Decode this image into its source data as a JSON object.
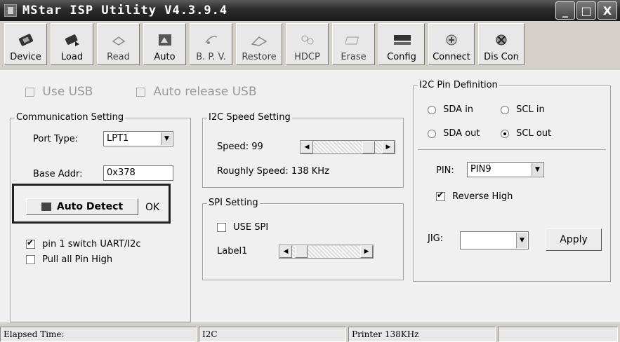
{
  "window": {
    "title": "MStar ISP Utility V4.3.9.4",
    "minimize": "_",
    "maximize": "□",
    "close": "X"
  },
  "toolbar": [
    {
      "label": "Device",
      "icon": "device-icon"
    },
    {
      "label": "Load",
      "icon": "load-icon"
    },
    {
      "label": "Read",
      "icon": "read-icon"
    },
    {
      "label": "Auto",
      "icon": "auto-icon"
    },
    {
      "label": "B. P. V.",
      "icon": "bpv-icon"
    },
    {
      "label": "Restore",
      "icon": "restore-icon"
    },
    {
      "label": "HDCP",
      "icon": "hdcp-icon"
    },
    {
      "label": "Erase",
      "icon": "erase-icon"
    },
    {
      "label": "Config",
      "icon": "config-icon"
    },
    {
      "label": "Connect",
      "icon": "connect-icon"
    },
    {
      "label": "Dis Con",
      "icon": "disconnect-icon"
    }
  ],
  "usb": {
    "use_usb": "Use USB",
    "auto_release_usb": "Auto release USB"
  },
  "communication": {
    "title": "Communication Setting",
    "port_type_label": "Port Type:",
    "port_type_value": "LPT1",
    "base_addr_label": "Base Addr:",
    "base_addr_value": "0x378",
    "auto_detect": "Auto Detect",
    "status": "OK",
    "pin1_switch": "pin 1 switch UART/I2c",
    "pull_all": "Pull all Pin High"
  },
  "i2c_speed": {
    "title": "I2C Speed Setting",
    "speed_label": "Speed: 99",
    "rough_speed": "Roughly Speed: 138 KHz"
  },
  "spi": {
    "title": "SPI Setting",
    "use_spi": "USE SPI",
    "label1": "Label1"
  },
  "i2c_pin": {
    "title": "I2C Pin Definition",
    "sda_in": "SDA in",
    "scl_in": "SCL in",
    "sda_out": "SDA out",
    "scl_out": "SCL out",
    "pin_label": "PIN:",
    "pin_value": "PIN9",
    "reverse_high": "Reverse High"
  },
  "jig": {
    "label": "JIG:",
    "value": "",
    "apply": "Apply"
  },
  "status_bar": {
    "elapsed": "Elapsed Time:",
    "mode": "I2C",
    "printer": "Printer  138KHz",
    "extra": ""
  },
  "colors": {
    "highlight_border": "#222222",
    "window_bg": "#f0f0f0"
  }
}
